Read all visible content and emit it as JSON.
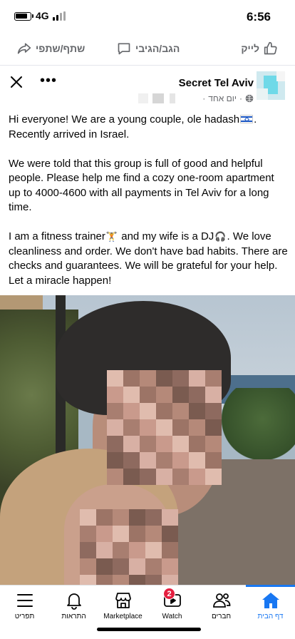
{
  "status_bar": {
    "network": "4G",
    "time": "6:56"
  },
  "actions": {
    "like_label": "לייק",
    "comment_label": "הגב/הגיבי",
    "share_label": "שתף/שתפי"
  },
  "post": {
    "group_name": "Secret Tel Aviv",
    "timestamp": "יום אחד",
    "paragraphs": [
      [
        "Hi everyone!  We are a young couple, ole hadash",
        ".",
        " Recently arrived in Israel."
      ],
      "We were told that this group is full of good and helpful people.  Please help me find a cozy one-room apartment up to 4000-4600 with all payments in Tel Aviv for a long time.",
      [
        "I am a fitness trainer",
        " and my wife is a DJ",
        ".  We love cleanliness and order. We don't have bad habits. There are checks and guarantees.  We will be grateful for your help. Let a miracle happen!"
      ]
    ]
  },
  "bottom_nav": {
    "items": [
      {
        "label": "תפריט",
        "icon": "menu-icon"
      },
      {
        "label": "התראות",
        "icon": "bell-icon"
      },
      {
        "label": "Marketplace",
        "icon": "shop-icon"
      },
      {
        "label": "Watch",
        "icon": "video-icon",
        "badge": "2"
      },
      {
        "label": "חברים",
        "icon": "friends-icon"
      },
      {
        "label": "דף הבית",
        "icon": "home-icon",
        "active": true
      }
    ]
  },
  "colors": {
    "accent": "#1877f2",
    "badge": "#e41e3f",
    "secondary_text": "#65676b"
  }
}
